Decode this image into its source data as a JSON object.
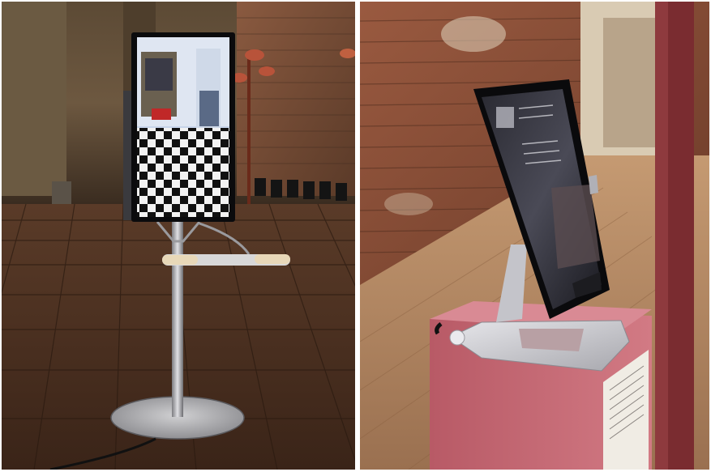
{
  "image": {
    "panels": [
      {
        "id": "left",
        "subject": "kiosk-floor-stand-display",
        "background": "brick-church-interior"
      },
      {
        "id": "right",
        "subject": "tablet-on-stand-on-pedestal",
        "background": "brick-wall-wooden-floor"
      }
    ],
    "colors": {
      "floor_left": "#4a2d1e",
      "brick_left": "#7a5038",
      "floor_right": "#b48a66",
      "brick_right": "#8c4a34",
      "pedestal": "#c66a75",
      "stand_metal": "#c8c8cc"
    }
  }
}
